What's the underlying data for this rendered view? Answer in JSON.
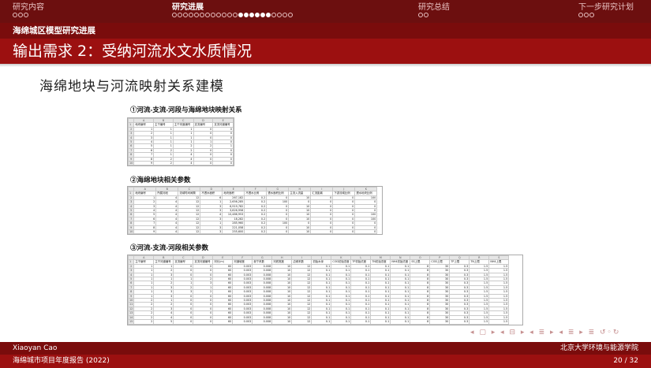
{
  "nav": {
    "sections": [
      {
        "label": "研究内容",
        "dots": 3,
        "filled": []
      },
      {
        "label": "研究进展",
        "dots": 22,
        "filled": [
          12,
          13,
          14,
          15,
          16,
          17
        ],
        "current_dot": 17
      },
      {
        "label": "研究总结",
        "dots": 2,
        "filled": []
      },
      {
        "label": "下一步研究计划",
        "dots": 3,
        "filled": []
      }
    ],
    "current_section": 1
  },
  "header": {
    "subsection": "海绵城区模型研究进展",
    "title": "输出需求 2：受纳河流水文水质情况"
  },
  "content": {
    "section_title": "海绵地块与河流映射关系建模",
    "tables": [
      {
        "caption": "①河流-支流-河段与海绵地块映射关系",
        "col_letters": [
          "A",
          "B",
          "C",
          "D",
          "E"
        ],
        "headers": [
          "地块编号",
          "主干编号",
          "主干河道编号",
          "支流编号",
          "支流河道编号"
        ],
        "rows": [
          [
            "1",
            "1",
            "1",
            "0",
            "0"
          ],
          [
            "2",
            "1",
            "1",
            "0",
            "0"
          ],
          [
            "3",
            "1",
            "1",
            "0",
            "0"
          ],
          [
            "4",
            "1",
            "1",
            "1",
            "0"
          ],
          [
            "5",
            "1",
            "2",
            "2",
            "1"
          ],
          [
            "6",
            "2",
            "2",
            "0",
            "0"
          ],
          [
            "7",
            "1",
            "4",
            "0",
            "0"
          ],
          [
            "8",
            "2",
            "4",
            "0",
            "0"
          ],
          [
            "9",
            "2",
            "4",
            "0",
            "0"
          ]
        ]
      },
      {
        "caption": "②海绵地块相关参数",
        "col_letters": [
          "A",
          "B",
          "C",
          "D",
          "E",
          "F",
          "G",
          "H",
          "I",
          "J",
          "K"
        ],
        "headers": [
          "地块编号",
          "所属河段",
          "流域时间间隔",
          "不透水面积",
          "地块面积",
          "不透水比例",
          "透水面积比例",
          "主流入流量",
          "汇流距离",
          "下游流域比例",
          "透水地块比例"
        ],
        "rows": [
          [
            "1",
            "4",
            "12",
            "6",
            "267,182",
            "0.2",
            "0",
            "10",
            "0",
            "0",
            "100"
          ],
          [
            "2",
            "4",
            "12",
            "1",
            "2,656,285",
            "0.2",
            "100",
            "0",
            "0",
            "0",
            "0"
          ],
          [
            "3",
            "4",
            "12",
            "3",
            "6,919,782",
            "0.2",
            "0",
            "10",
            "0",
            "0",
            "0"
          ],
          [
            "4",
            "4",
            "12",
            "3",
            "3,626,958",
            "0.2",
            "0",
            "10",
            "0",
            "0",
            "0"
          ],
          [
            "5",
            "4",
            "12",
            "4",
            "10,486,953",
            "0.2",
            "0",
            "10",
            "0",
            "0",
            "100"
          ],
          [
            "6",
            "4",
            "12",
            "3",
            "18,282",
            "0.2",
            "0",
            "10",
            "0",
            "0",
            "100"
          ],
          [
            "7",
            "4",
            "12",
            "1",
            "285,960",
            "0.2",
            "100",
            "0",
            "0",
            "0",
            "0"
          ],
          [
            "8",
            "4",
            "12",
            "3",
            "221,058",
            "0.2",
            "0",
            "10",
            "0",
            "0",
            "0"
          ],
          [
            "9",
            "4",
            "12",
            "3",
            "255,600",
            "0.2",
            "0",
            "10",
            "0",
            "0",
            "0"
          ]
        ]
      },
      {
        "caption": "③河流-支流-河段相关参数",
        "col_letters": [
          "A",
          "B",
          "C",
          "D",
          "E",
          "F",
          "G",
          "H",
          "I",
          "J",
          "K",
          "L",
          "M",
          "N",
          "O",
          "P",
          "Q",
          "R",
          "S"
        ],
        "headers": [
          "主干编号",
          "主干河道编号",
          "支流编号",
          "支流河道编号",
          "河长(m)",
          "河道坡度",
          "曼宁系数",
          "河底宽度",
          "边坡系数",
          "初始水深",
          "COD初始浓度",
          "TP初始浓度",
          "TN初始浓度",
          "NH4初始浓度",
          "SS上限",
          "COD上限",
          "TP上限",
          "TN上限",
          "NH4上限"
        ],
        "rows": [
          [
            "1",
            "1",
            "0",
            "0",
            "60",
            "0.003",
            "0.008",
            "10",
            "12",
            "0.1",
            "0.1",
            "0.1",
            "0.1",
            "0.1",
            "8",
            "30",
            "0.3",
            "1.5",
            "1.5"
          ],
          [
            "1",
            "2",
            "0",
            "0",
            "60",
            "0.003",
            "0.008",
            "10",
            "12",
            "0.1",
            "0.1",
            "0.1",
            "0.1",
            "0.1",
            "8",
            "30",
            "0.3",
            "1.5",
            "1.5"
          ],
          [
            "1",
            "3",
            "0",
            "0",
            "60",
            "0.003",
            "0.008",
            "10",
            "12",
            "0.1",
            "0.1",
            "0.1",
            "0.1",
            "0.1",
            "8",
            "30",
            "0.3",
            "1.5",
            "1.5"
          ],
          [
            "1",
            "1",
            "1",
            "2",
            "60",
            "0.003",
            "0.008",
            "10",
            "12",
            "0.1",
            "0.1",
            "0.1",
            "0.1",
            "0.1",
            "8",
            "30",
            "0.3",
            "1.5",
            "1.5"
          ],
          [
            "1",
            "2",
            "1",
            "3",
            "60",
            "0.003",
            "0.008",
            "10",
            "12",
            "0.1",
            "0.1",
            "0.1",
            "0.1",
            "0.1",
            "8",
            "30",
            "0.3",
            "1.5",
            "1.5"
          ],
          [
            "1",
            "3",
            "2",
            "1",
            "60",
            "0.003",
            "0.008",
            "10",
            "12",
            "0.1",
            "0.1",
            "0.1",
            "0.1",
            "0.1",
            "8",
            "30",
            "0.3",
            "1.5",
            "1.5"
          ],
          [
            "1",
            "3",
            "3",
            "2",
            "60",
            "0.003",
            "0.008",
            "10",
            "12",
            "0.1",
            "0.1",
            "0.1",
            "0.1",
            "0.1",
            "8",
            "30",
            "0.3",
            "1.5",
            "1.5"
          ],
          [
            "1",
            "3",
            "0",
            "0",
            "60",
            "0.003",
            "0.008",
            "10",
            "12",
            "0.1",
            "0.1",
            "0.1",
            "0.1",
            "0.1",
            "8",
            "30",
            "0.3",
            "1.5",
            "1.5"
          ],
          [
            "2",
            "1",
            "0",
            "0",
            "60",
            "0.003",
            "0.008",
            "10",
            "12",
            "0.1",
            "0.1",
            "0.1",
            "0.1",
            "0.1",
            "8",
            "30",
            "0.3",
            "1.5",
            "1.5"
          ],
          [
            "2",
            "2",
            "0",
            "0",
            "60",
            "0.003",
            "0.008",
            "10",
            "12",
            "0.1",
            "0.1",
            "0.1",
            "0.1",
            "0.1",
            "8",
            "30",
            "0.3",
            "1.5",
            "1.5"
          ],
          [
            "2",
            "3",
            "0",
            "0",
            "60",
            "0.003",
            "0.008",
            "10",
            "12",
            "0.1",
            "0.1",
            "0.1",
            "0.1",
            "0.1",
            "8",
            "30",
            "0.3",
            "1.5",
            "1.5"
          ],
          [
            "2",
            "4",
            "0",
            "0",
            "60",
            "0.003",
            "0.008",
            "10",
            "12",
            "0.1",
            "0.1",
            "0.1",
            "0.1",
            "0.1",
            "8",
            "30",
            "0.3",
            "1.5",
            "1.5"
          ],
          [
            "2",
            "4",
            "0",
            "0",
            "60",
            "0.003",
            "0.008",
            "10",
            "12",
            "0.1",
            "0.1",
            "0.1",
            "0.1",
            "0.1",
            "8",
            "30",
            "0.3",
            "1.5",
            "1.5"
          ],
          [
            "2",
            "5",
            "0",
            "0",
            "60",
            "0.003",
            "0.008",
            "10",
            "12",
            "0.1",
            "0.1",
            "0.1",
            "0.1",
            "0.1",
            "8",
            "30",
            "0.3",
            "1.5",
            "1.5"
          ]
        ]
      }
    ]
  },
  "nav_controls": "◂ ▢ ▸ ◂ ⊟ ▸ ◂ ≣ ▸ ◂ ≣ ▸ ≣ ↺◦↻",
  "footer": {
    "author": "Xiaoyan Cao",
    "institution": "北京大学环境与能源学院",
    "report": "海绵城市项目年度报告 (2022)",
    "page": "20 / 32"
  },
  "colors": {
    "dark": "#6c0f0f",
    "mid": "#7a0c0c",
    "accent": "#9c1010"
  }
}
